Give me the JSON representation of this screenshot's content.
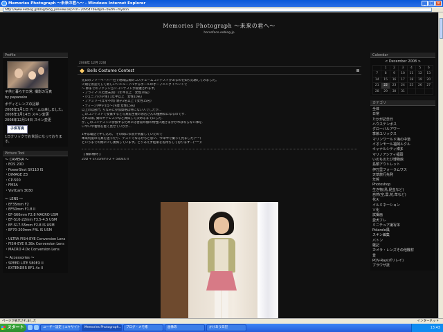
{
  "window": {
    "title": "Memories Photograph 〜未来の君へ〜 - Windows Internet Explorer",
    "address": "http://www.exblog.jp/blog/blog_preview.asp?srl=2095470&dgid=0&tm=myskin"
  },
  "site": {
    "title": "Memories Photograph 〜未来の君へ〜",
    "subtitle": "horseface.exblog.jp"
  },
  "profile": {
    "heading": "Profile",
    "caption1": "子供と暮らす日常, 撮影の写真",
    "caption2": "by papaneko",
    "lines": [
      "ボディとレンズの記録",
      "2008年1月1日 Iリーム以来しました。",
      "2008年1月14日 スキン変更",
      "2008年12月14日 スキン変更"
    ],
    "button": "子供写真",
    "button_note": "1日クリックでお世話になっております。"
  },
  "tools": {
    "heading": "Picture Tool",
    "lines": [
      "〜 CAMERA 〜",
      "・EOS 20D",
      "・PowerShot SX110 IS",
      "・DiMAGE Z3",
      "・CP-500",
      "・FM3A",
      "・VivtCam 3030",
      "",
      "〜 LENS 〜",
      "・EF35mm F2",
      "・EF50mm F1.8 II",
      "・EF-S60mm F2.8 MACRO USM",
      "・EF-S10-22mm F3.5-4.5 USM",
      "・EF-S17-55mm F2.8 IS USM",
      "・EF70-200mm F4L IS USM",
      "",
      "・ULTRA FISH-EYE Conversion Lens",
      "・FISH-EYE 0.38x Conversion Lens",
      "・MACRO 4.0x Conversion Lens",
      "",
      "〜 Accessories 〜",
      "・SPEED LITE 580EX II",
      "・EXTENDER EF1.4x II"
    ]
  },
  "post": {
    "date": "2008年 12月 22日",
    "title": "Bells Costume Contest",
    "lines": [
      "先日のフリーペーパー社で地域広場のコスチュームコンテストがあるのを知り応募してみました。",
      "少期をお迎えして新しいリニューアルするホールのオープニングイベントで",
      "〜 姉までのファッションコンテストが開催されます。",
      "・プライマリ(七歳未満): 1年半以上　女性10名)",
      "・ジュニア(小学生) 1年半以上　女性10名)",
      "・ファミリー(年令不問) 親子2名以上で女性15名)",
      "・ティーン(中学1年〜19歳 女性15名)",
      "以上のは部門, ちなみに参加資格は特にない人でしたが...",
      "このコンテストで受賞すると写真館主催のお店さんの優勝枠になるのです.",
      "それ以来, 資料やテレスタなど真似して決めるまでにした.",
      "が, このコンテストに参加するためには普段の娘の特性に磨きまかかればならない事を.",
      "いやいや着物を着て見せていかが...",
      "",
      "1件は電話で申し込み。 その間に衣装が到着していたので",
      "本来何度の写真を送ったり、テストでなるかもと思い、今年中で撮って見ました(^^)",
      "というまでの間に少し後悔しています。とりあえず結果をお待ちしております...(^^)/"
    ],
    "exif_label": "【 撮影機材 】",
    "exif": "20D + EF35mm F2 + 580EX II"
  },
  "calendar": {
    "heading": "Calendar",
    "month": "< December 2008 >",
    "days": [
      "",
      "1",
      "2",
      "3",
      "4",
      "5",
      "6",
      "7",
      "8",
      "9",
      "10",
      "11",
      "12",
      "13",
      "14",
      "15",
      "16",
      "17",
      "18",
      "19",
      "20",
      "21",
      "22",
      "23",
      "24",
      "25",
      "26",
      "27",
      "28",
      "29",
      "30",
      "31",
      "",
      "",
      ""
    ],
    "today": "22"
  },
  "categories": {
    "heading": "カテゴリ",
    "items": [
      "全体",
      "日常",
      "たかが記念日",
      "ハウステンボス",
      "グローバルアワー",
      "季節ユリックス",
      "マリンワールド海の中道",
      "イオンモール福岡ルクル",
      "キャナルシティ博多",
      "マリノアシティ福岡",
      "いのちのたび博物館",
      "島類アウトレット",
      "伊万里フォーラムワス",
      "天草旅行先発",
      "年賀",
      "Photoshop",
      "生き物(鳥,昆虫など)",
      "自然(空,雲,花,草など)",
      "花火",
      "イルミネーション",
      "ソ化",
      "試撮画",
      "愛犬フレ",
      "ミニチュア撮写体",
      "Polarole風",
      "スキン編集",
      "バトン",
      "雑記",
      "カメラ・レンズその他機材",
      "景",
      "POV-Ray(ポリレイ)",
      "ブラウザ技"
    ]
  },
  "status": {
    "text": "ページが表示されました",
    "zone": "インターネット"
  },
  "taskbar": {
    "start": "スタート",
    "tasks": [
      "ユーザー設定 | エキサイト...",
      "Memories Photograph...",
      "ブログ - メモ帳",
      "画像等",
      "かけあう日記"
    ],
    "time": "13:43"
  }
}
